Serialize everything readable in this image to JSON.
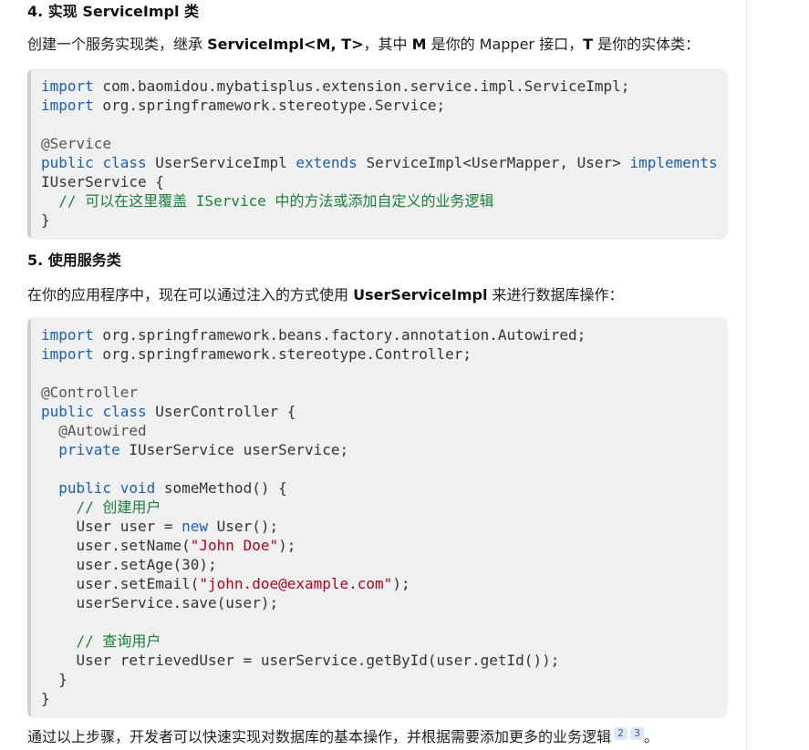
{
  "section4": {
    "heading": "4. 实现 ServiceImpl 类",
    "intro": {
      "p1": "创建一个服务实现类，继承 ",
      "b1": "ServiceImpl<M, T>",
      "p2": "，其中 ",
      "b2": "M",
      "p3": " 是你的 Mapper 接口，",
      "b3": "T",
      "p4": " 是你的实体类："
    },
    "code": [
      [
        {
          "t": "import",
          "c": "kw"
        },
        {
          "t": " com.baomidou.mybatisplus.extension.service.impl.ServiceImpl;"
        }
      ],
      [
        {
          "t": "import",
          "c": "kw"
        },
        {
          "t": " org.springframework.stereotype.Service;"
        }
      ],
      [],
      [
        {
          "t": "@Service",
          "c": "an"
        }
      ],
      [
        {
          "t": "public",
          "c": "kw"
        },
        {
          "t": " "
        },
        {
          "t": "class",
          "c": "kw"
        },
        {
          "t": " UserServiceImpl "
        },
        {
          "t": "extends",
          "c": "kw"
        },
        {
          "t": " ServiceImpl<UserMapper, User> "
        },
        {
          "t": "implements",
          "c": "kw"
        }
      ],
      [
        {
          "t": "IUserService {"
        }
      ],
      [
        {
          "t": "  "
        },
        {
          "t": "// 可以在这里覆盖 IService 中的方法或添加自定义的业务逻辑",
          "c": "cm"
        }
      ],
      [
        {
          "t": "}"
        }
      ]
    ]
  },
  "section5": {
    "heading": "5. 使用服务类",
    "intro": {
      "p1": "在你的应用程序中，现在可以通过注入的方式使用 ",
      "b1": "UserServiceImpl",
      "p2": " 来进行数据库操作："
    },
    "code": [
      [
        {
          "t": "import",
          "c": "kw"
        },
        {
          "t": " org.springframework.beans.factory.annotation.Autowired;"
        }
      ],
      [
        {
          "t": "import",
          "c": "kw"
        },
        {
          "t": " org.springframework.stereotype.Controller;"
        }
      ],
      [],
      [
        {
          "t": "@Controller",
          "c": "an"
        }
      ],
      [
        {
          "t": "public",
          "c": "kw"
        },
        {
          "t": " "
        },
        {
          "t": "class",
          "c": "kw"
        },
        {
          "t": " UserController {"
        }
      ],
      [
        {
          "t": "  "
        },
        {
          "t": "@Autowired",
          "c": "an"
        }
      ],
      [
        {
          "t": "  "
        },
        {
          "t": "private",
          "c": "kw"
        },
        {
          "t": " IUserService userService;"
        }
      ],
      [],
      [
        {
          "t": "  "
        },
        {
          "t": "public",
          "c": "kw"
        },
        {
          "t": " "
        },
        {
          "t": "void",
          "c": "kw"
        },
        {
          "t": " someMethod() {"
        }
      ],
      [
        {
          "t": "    "
        },
        {
          "t": "// 创建用户",
          "c": "cm"
        }
      ],
      [
        {
          "t": "    User user = "
        },
        {
          "t": "new",
          "c": "kw"
        },
        {
          "t": " User();"
        }
      ],
      [
        {
          "t": "    user.setName("
        },
        {
          "t": "\"John Doe\"",
          "c": "st"
        },
        {
          "t": ");"
        }
      ],
      [
        {
          "t": "    user.setAge(30);"
        }
      ],
      [
        {
          "t": "    user.setEmail("
        },
        {
          "t": "\"john.doe@example.com\"",
          "c": "st"
        },
        {
          "t": ");"
        }
      ],
      [
        {
          "t": "    userService.save(user);"
        }
      ],
      [],
      [
        {
          "t": "    "
        },
        {
          "t": "// 查询用户",
          "c": "cm"
        }
      ],
      [
        {
          "t": "    User retrievedUser = userService.getById(user.getId());"
        }
      ],
      [
        {
          "t": "  }"
        }
      ],
      [
        {
          "t": "}"
        }
      ]
    ]
  },
  "conclusion": {
    "text": "通过以上步骤，开发者可以快速实现对数据库的基本操作，并根据需要添加更多的业务逻辑",
    "citations": [
      "2",
      "3"
    ],
    "end": "。"
  }
}
